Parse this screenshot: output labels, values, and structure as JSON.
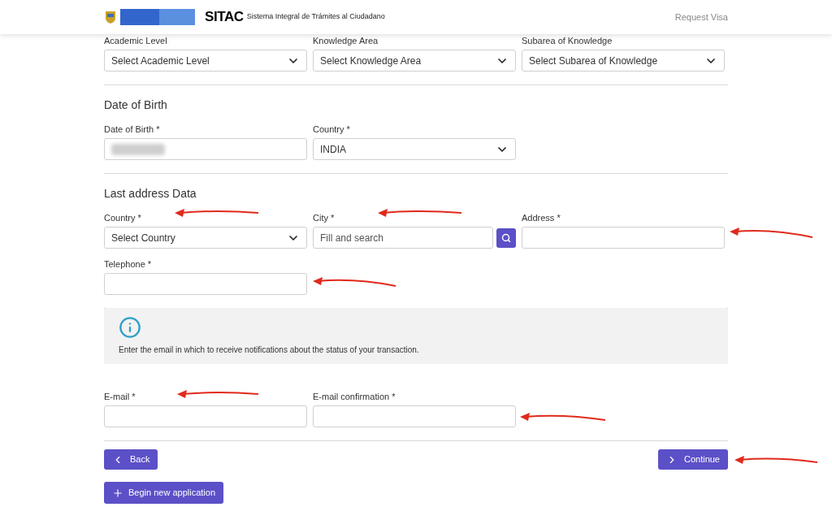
{
  "header": {
    "brand": "SITAC",
    "subtitle": "Sistema Integral de Trámites al Ciudadano",
    "link": "Request Visa"
  },
  "top_fields": [
    {
      "label": "Academic Level",
      "kind": "select",
      "value": "Select Academic Level"
    },
    {
      "label": "Knowledge Area",
      "kind": "select",
      "value": "Select Knowledge Area"
    },
    {
      "label": "Subarea of Knowledge",
      "kind": "select",
      "value": "Select Subarea of Knowledge"
    }
  ],
  "sections": [
    {
      "title": "Date of Birth",
      "rows": [
        [
          {
            "label": "Date of Birth *",
            "kind": "redacted"
          },
          {
            "label": "Country *",
            "kind": "select",
            "value": "INDIA"
          }
        ]
      ]
    },
    {
      "title": "Last address Data",
      "rows": [
        [
          {
            "label": "Country *",
            "kind": "select",
            "value": "Select Country"
          },
          {
            "label": "City *",
            "kind": "search",
            "placeholder": "Fill and search"
          },
          {
            "label": "Address *",
            "kind": "text"
          }
        ],
        [
          {
            "label": "Telephone *",
            "kind": "text"
          }
        ]
      ]
    }
  ],
  "notice": {
    "message": "Enter the email in which to receive notifications about the status of your transaction."
  },
  "email_fields": [
    {
      "label": "E-mail *",
      "kind": "text"
    },
    {
      "label": "E-mail confirmation *",
      "kind": "text"
    }
  ],
  "buttons": {
    "back": "Back",
    "continue": "Continue",
    "new": "Begin new application"
  }
}
